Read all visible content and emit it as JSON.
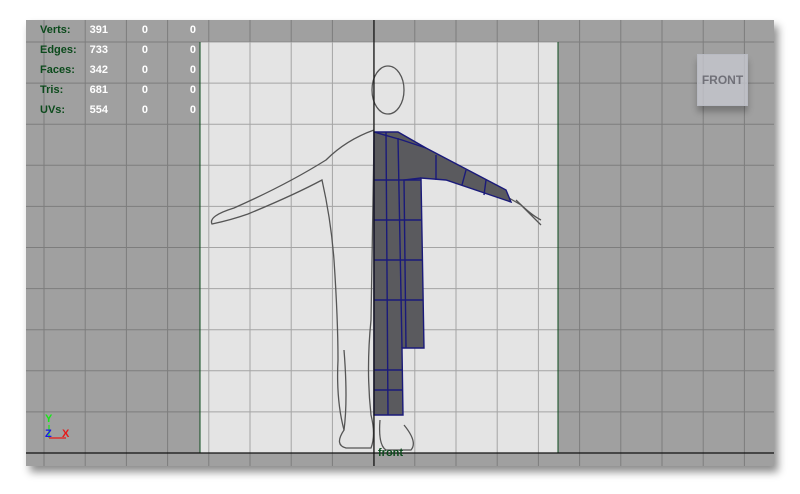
{
  "stats": [
    {
      "label": "Verts:",
      "values": [
        "391",
        "0",
        "0"
      ]
    },
    {
      "label": "Edges:",
      "values": [
        "733",
        "0",
        "0"
      ]
    },
    {
      "label": "Faces:",
      "values": [
        "342",
        "0",
        "0"
      ]
    },
    {
      "label": "Tris:",
      "values": [
        "681",
        "0",
        "0"
      ]
    },
    {
      "label": "UVs:",
      "values": [
        "554",
        "0",
        "0"
      ]
    }
  ],
  "view_cube_label": "FRONT",
  "camera_label": "front",
  "axes": {
    "y": "Y",
    "z": "Z",
    "x": "X"
  },
  "colors": {
    "viewport_bg": "#a0a0a0",
    "hud_label": "#0c4a1c",
    "image_plane": "#e4e4e4",
    "mesh": "#5a5a5e",
    "mesh_wire": "#1a1a7a"
  }
}
